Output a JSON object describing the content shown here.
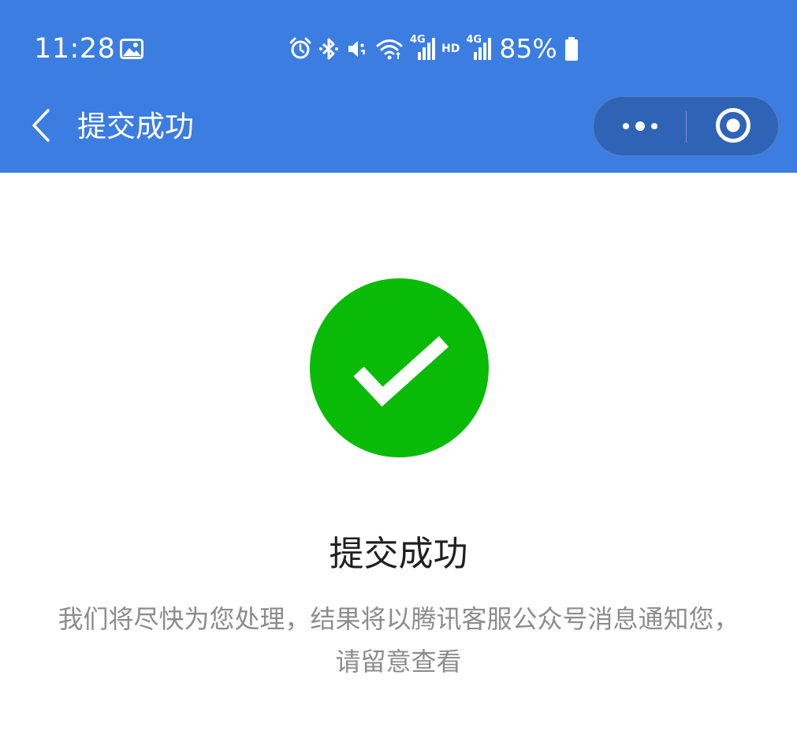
{
  "status_bar": {
    "time": "11:28",
    "battery": "85%",
    "network_label": "4G",
    "hd_label": "HD",
    "icons": [
      "image-icon",
      "alarm-icon",
      "bluetooth-icon",
      "mute-icon",
      "wifi-icon",
      "signal-icon",
      "battery-icon"
    ]
  },
  "nav": {
    "title": "提交成功",
    "back_icon": "chevron-left-icon",
    "more_icon": "more-dots-icon",
    "close_icon": "record-circle-icon"
  },
  "result": {
    "icon": "check-circle-icon",
    "title": "提交成功",
    "description": "我们将尽快为您处理，结果将以腾讯客服公众号消息通知您，请留意查看"
  },
  "colors": {
    "header_bg": "#3b7de0",
    "capsule_bg": "#2f63b5",
    "success_green": "#09bb07",
    "title_text": "#1f1f1f",
    "desc_text": "#8c8c8c"
  }
}
